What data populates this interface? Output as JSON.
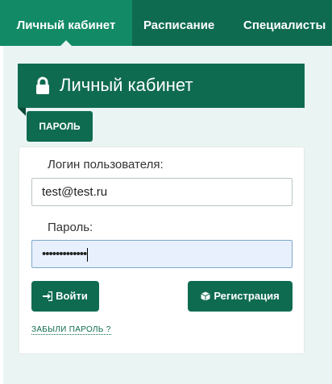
{
  "nav": {
    "tabs": [
      {
        "label": "Личный кабинет"
      },
      {
        "label": "Расписание"
      },
      {
        "label": "Специалисты"
      }
    ]
  },
  "header": {
    "title": "Личный кабинет",
    "icon": "lock-icon"
  },
  "tab_password": {
    "label": "ПАРОЛЬ"
  },
  "form": {
    "login_label": "Логин пользователя:",
    "login_value": "test@test.ru",
    "password_label": "Пароль:",
    "password_value": "•••••••••••••",
    "login_button": "Войти",
    "register_button": "Регистрация",
    "forgot_link": "ЗАБЫЛИ ПАРОЛЬ ?"
  },
  "colors": {
    "brand": "#0f6b50",
    "active_tab": "#138a66",
    "page_bg": "#eaf5f3",
    "focused_input": "#e8f0fe"
  }
}
